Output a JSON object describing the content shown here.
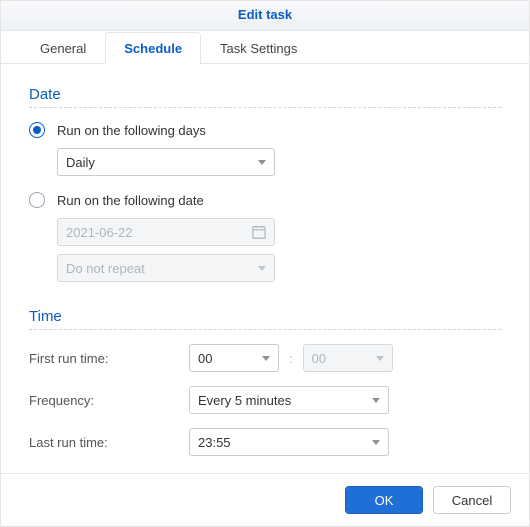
{
  "title": "Edit task",
  "tabs": [
    {
      "label": "General"
    },
    {
      "label": "Schedule"
    },
    {
      "label": "Task Settings"
    }
  ],
  "active_tab": 1,
  "sections": {
    "date": {
      "title": "Date",
      "radio_days_label": "Run on the following days",
      "radio_date_label": "Run on the following date",
      "frequency_select": "Daily",
      "date_value": "2021-06-22",
      "repeat_select": "Do not repeat"
    },
    "time": {
      "title": "Time",
      "first_run_label": "First run time:",
      "first_run_hour": "00",
      "first_run_minute": "00",
      "frequency_label": "Frequency:",
      "frequency_value": "Every 5 minutes",
      "last_run_label": "Last run time:",
      "last_run_value": "23:55"
    }
  },
  "footer": {
    "ok": "OK",
    "cancel": "Cancel"
  }
}
